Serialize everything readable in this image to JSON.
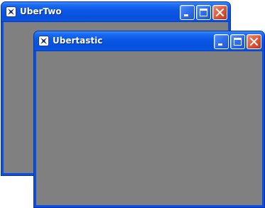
{
  "windows": [
    {
      "title": "UberTwo",
      "icon": "app-star-icon",
      "buttons": [
        "minimize-icon",
        "maximize-icon",
        "close-icon"
      ],
      "client_color": "#808080"
    },
    {
      "title": "Ubertastic",
      "icon": "app-star-icon",
      "buttons": [
        "minimize-icon",
        "maximize-icon",
        "close-icon"
      ],
      "client_color": "#808080"
    }
  ],
  "colors": {
    "titlebar": "#0750dc",
    "frame": "#0a4fe0",
    "close": "#e0593a",
    "client": "#808080"
  }
}
